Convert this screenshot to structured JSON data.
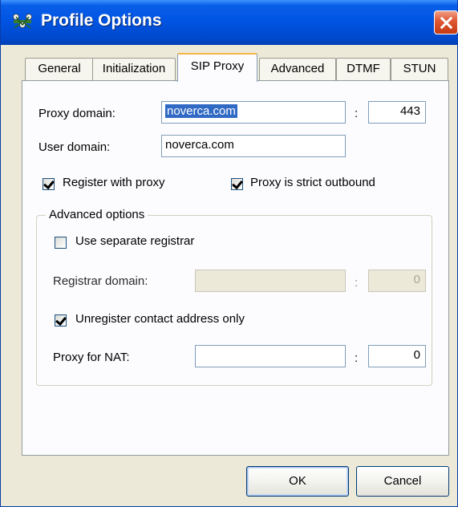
{
  "window": {
    "title": "Profile Options",
    "icon": "network-icon",
    "close_icon": "close-icon"
  },
  "tabs": [
    {
      "label": "General",
      "active": false
    },
    {
      "label": "Initialization",
      "active": false
    },
    {
      "label": "SIP Proxy",
      "active": true
    },
    {
      "label": "Advanced",
      "active": false
    },
    {
      "label": "DTMF",
      "active": false
    },
    {
      "label": "STUN",
      "active": false
    }
  ],
  "sip_proxy": {
    "proxy_domain_label": "Proxy domain:",
    "proxy_domain_value": "noverca.com",
    "colon": ":",
    "proxy_port_value": "443",
    "user_domain_label": "User domain:",
    "user_domain_value": "noverca.com",
    "register_with_proxy_label": "Register with proxy",
    "register_with_proxy_checked": true,
    "proxy_strict_outbound_label": "Proxy is strict outbound",
    "proxy_strict_outbound_checked": true
  },
  "advanced_options": {
    "title": "Advanced options",
    "use_separate_registrar_label": "Use separate registrar",
    "use_separate_registrar_checked": false,
    "registrar_domain_label": "Registrar domain:",
    "registrar_domain_value": "",
    "registrar_port_value": "0",
    "unregister_contact_label": "Unregister contact address only",
    "unregister_contact_checked": true,
    "proxy_for_nat_label": "Proxy for NAT:",
    "proxy_for_nat_value": "",
    "proxy_for_nat_port_value": "0"
  },
  "buttons": {
    "ok": "OK",
    "cancel": "Cancel"
  }
}
